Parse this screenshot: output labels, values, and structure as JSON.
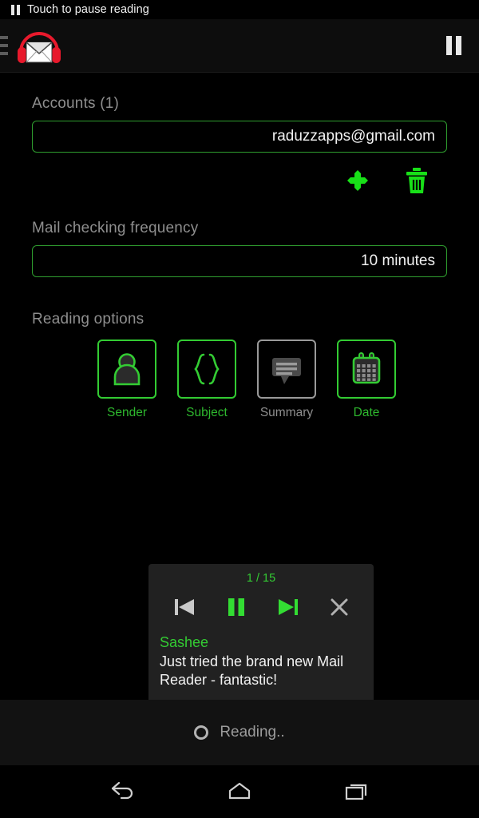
{
  "status_bar": {
    "icon": "pause-icon",
    "text": "Touch to pause reading"
  },
  "app_bar": {
    "logo": "headphone-envelope-logo",
    "drawer_icon": "hamburger-menu-icon",
    "pause_icon": "pause-icon"
  },
  "accounts": {
    "label": "Accounts (1)",
    "value": "raduzzapps@gmail.com",
    "add_icon": "plus-icon",
    "delete_icon": "trash-icon"
  },
  "frequency": {
    "label": "Mail checking frequency",
    "value": "10 minutes"
  },
  "reading_options": {
    "label": "Reading options",
    "items": [
      {
        "label": "Sender",
        "icon": "person-icon",
        "active": true
      },
      {
        "label": "Subject",
        "icon": "curly-braces-icon",
        "active": true
      },
      {
        "label": "Summary",
        "icon": "speech-bubble-icon",
        "active": false
      },
      {
        "label": "Date",
        "icon": "calendar-icon",
        "active": true
      }
    ]
  },
  "player_card": {
    "counter": "1 / 15",
    "prev_icon": "previous-track-icon",
    "pause_icon": "pause-icon",
    "next_icon": "next-track-icon",
    "close_icon": "close-icon",
    "sender": "Sashee",
    "message": "Just tried the brand new Mail Reader - fantastic!"
  },
  "bottom_status": {
    "spinner_icon": "loading-spinner-icon",
    "text": "Reading.."
  },
  "nav_bar": {
    "back_icon": "back-arrow-icon",
    "home_icon": "home-icon",
    "recents_icon": "recent-apps-icon"
  },
  "colors": {
    "accent_green": "#33cc33",
    "border_green": "#2f9e2f",
    "inactive_gray": "#9a9a9a",
    "logo_red": "#e8192c"
  }
}
